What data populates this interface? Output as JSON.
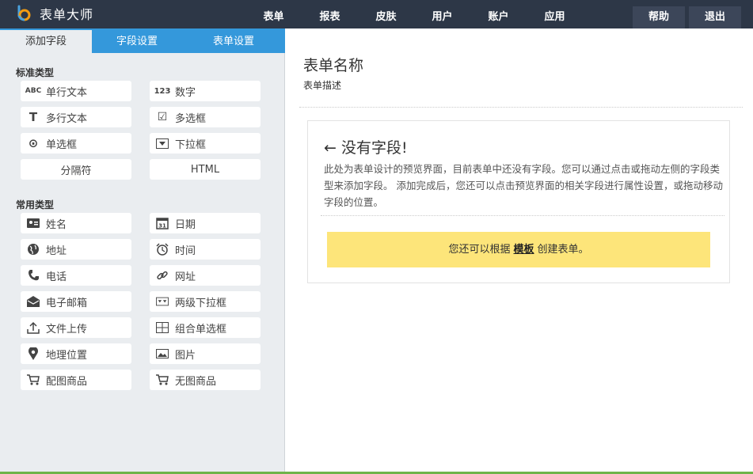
{
  "app": {
    "name": "表单大师",
    "logo_icon": "logo-b-icon"
  },
  "nav": {
    "items": [
      "表单",
      "报表",
      "皮肤",
      "用户",
      "账户",
      "应用"
    ],
    "help_label": "帮助",
    "exit_label": "退出"
  },
  "tabs": [
    {
      "label": "添加字段",
      "active": true
    },
    {
      "label": "字段设置",
      "active": false
    },
    {
      "label": "表单设置",
      "active": false
    }
  ],
  "standard": {
    "title": "标准类型",
    "items": [
      {
        "label": "单行文本",
        "icon": "abc-icon",
        "glyph": "ABC"
      },
      {
        "label": "数字",
        "icon": "number-icon",
        "glyph": "123"
      },
      {
        "label": "多行文本",
        "icon": "text-t-icon",
        "glyph": "T"
      },
      {
        "label": "多选框",
        "icon": "checkbox-icon",
        "glyph": "☑"
      },
      {
        "label": "单选框",
        "icon": "radio-icon",
        "glyph": "⊙"
      },
      {
        "label": "下拉框",
        "icon": "dropdown-icon",
        "glyph": "▾"
      },
      {
        "label": "分隔符",
        "icon": "",
        "glyph": ""
      },
      {
        "label": "HTML",
        "icon": "",
        "glyph": ""
      }
    ]
  },
  "common": {
    "title": "常用类型",
    "items": [
      {
        "label": "姓名",
        "icon": "name-card-icon",
        "glyph": "▬"
      },
      {
        "label": "日期",
        "icon": "calendar-icon",
        "glyph": "31"
      },
      {
        "label": "地址",
        "icon": "globe-icon",
        "glyph": "●"
      },
      {
        "label": "时间",
        "icon": "alarm-clock-icon",
        "glyph": "⏰"
      },
      {
        "label": "电话",
        "icon": "phone-icon",
        "glyph": "✆"
      },
      {
        "label": "网址",
        "icon": "link-icon",
        "glyph": "∞"
      },
      {
        "label": "电子邮箱",
        "icon": "envelope-icon",
        "glyph": "✉"
      },
      {
        "label": "两级下拉框",
        "icon": "two-level-dropdown-icon",
        "glyph": "▾▾"
      },
      {
        "label": "文件上传",
        "icon": "upload-icon",
        "glyph": "⇧"
      },
      {
        "label": "组合单选框",
        "icon": "grid-icon",
        "glyph": "⊞"
      },
      {
        "label": "地理位置",
        "icon": "map-pin-icon",
        "glyph": "●"
      },
      {
        "label": "图片",
        "icon": "image-icon",
        "glyph": "▭"
      },
      {
        "label": "配图商品",
        "icon": "cart-icon",
        "glyph": "🛒"
      },
      {
        "label": "无图商品",
        "icon": "cart-icon",
        "glyph": "🛒"
      }
    ]
  },
  "form": {
    "title": "表单名称",
    "description": "表单描述"
  },
  "empty": {
    "title": "← 没有字段!",
    "text": "此处为表单设计的预览界面，目前表单中还没有字段。您可以通过点击或拖动左侧的字段类型来添加字段。 添加完成后，您还可以点击预览界面的相关字段进行属性设置，或拖动移动字段的位置。",
    "tip_prefix": "您还可以根据",
    "tip_link": "模板",
    "tip_suffix": "创建表单。"
  },
  "colors": {
    "topbar": "#2d3747",
    "tab_blue": "#3498db",
    "tip_yellow": "#fde57a",
    "bottom_green": "#6fb44a"
  }
}
